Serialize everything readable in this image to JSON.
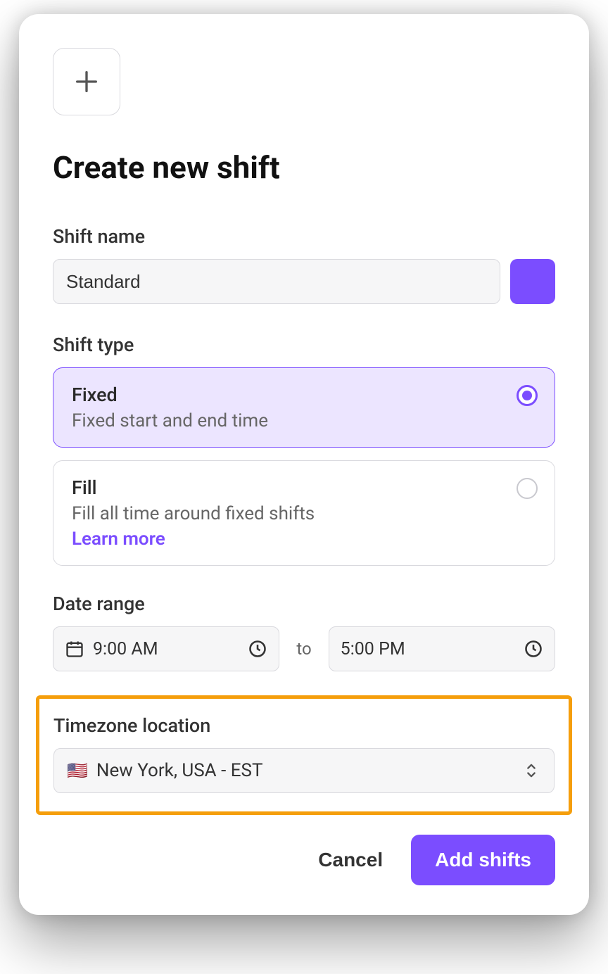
{
  "title": "Create new shift",
  "shift_name": {
    "label": "Shift name",
    "value": "Standard"
  },
  "color_swatch": "#7B4DFF",
  "shift_type": {
    "label": "Shift type",
    "options": {
      "fixed": {
        "title": "Fixed",
        "desc": "Fixed start and end time",
        "selected": true
      },
      "fill": {
        "title": "Fill",
        "desc": "Fill all time around fixed shifts",
        "learn_more": "Learn more",
        "selected": false
      }
    }
  },
  "date_range": {
    "label": "Date range",
    "start": "9:00 AM",
    "to": "to",
    "end": "5:00 PM"
  },
  "timezone": {
    "label": "Timezone location",
    "flag": "🇺🇸",
    "value": "New York, USA - EST"
  },
  "footer": {
    "cancel": "Cancel",
    "submit": "Add shifts"
  }
}
